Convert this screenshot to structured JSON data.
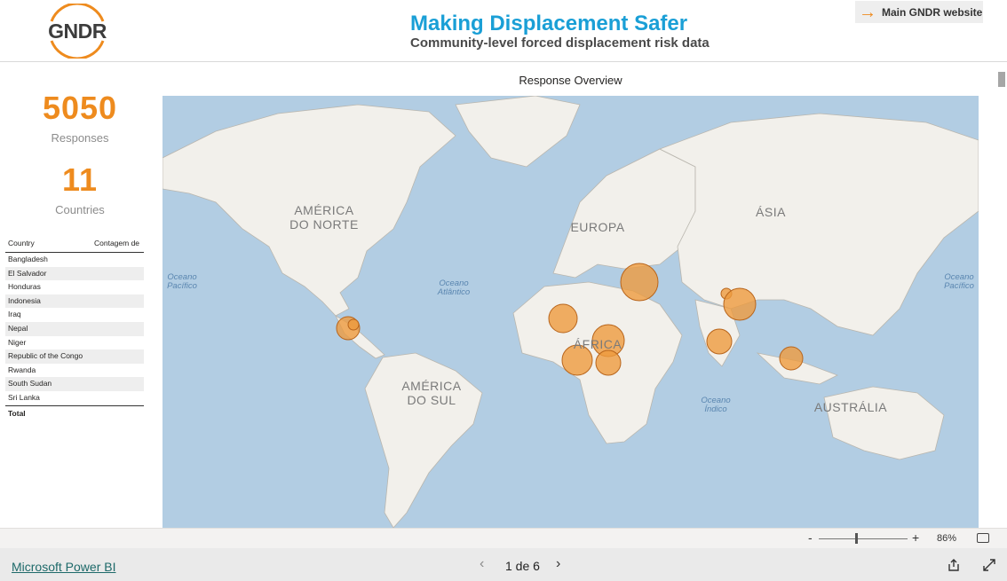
{
  "header": {
    "logo_text": "GNDR",
    "title": "Making Displacement Safer",
    "subtitle": "Community-level forced displacement risk data",
    "main_link_label": "Main GNDR website"
  },
  "kpis": {
    "responses_value": "5050",
    "responses_label": "Responses",
    "countries_value": "11",
    "countries_label": "Countries"
  },
  "country_table": {
    "headers": [
      "Country",
      "Contagem de"
    ],
    "rows": [
      "Bangladesh",
      "El Salvador",
      "Honduras",
      "Indonesia",
      "Iraq",
      "Nepal",
      "Niger",
      "Republic of the Congo",
      "Rwanda",
      "South Sudan",
      "Sri Lanka"
    ],
    "total_label": "Total"
  },
  "map": {
    "title": "Response Overview",
    "regions": [
      "AMÉRICA DO NORTE",
      "EUROPA",
      "ÁSIA",
      "ÁFRICA",
      "AMÉRICA DO SUL",
      "AUSTRÁLIA"
    ],
    "oceans": [
      "Oceano Pacífico",
      "Oceano Atlântico",
      "Oceano Índico",
      "Oceano Pacífico"
    ],
    "bubble_color": "#ee9b3e"
  },
  "zoom": {
    "minus": "-",
    "plus": "+",
    "value": "86%"
  },
  "footer": {
    "powerbi_link": "Microsoft Power BI",
    "page_indicator": "1 de 6"
  },
  "colors": {
    "accent": "#ee8b1e",
    "title_blue": "#1a9fd6",
    "ocean": "#b2cde3",
    "land": "#f2f0eb"
  }
}
